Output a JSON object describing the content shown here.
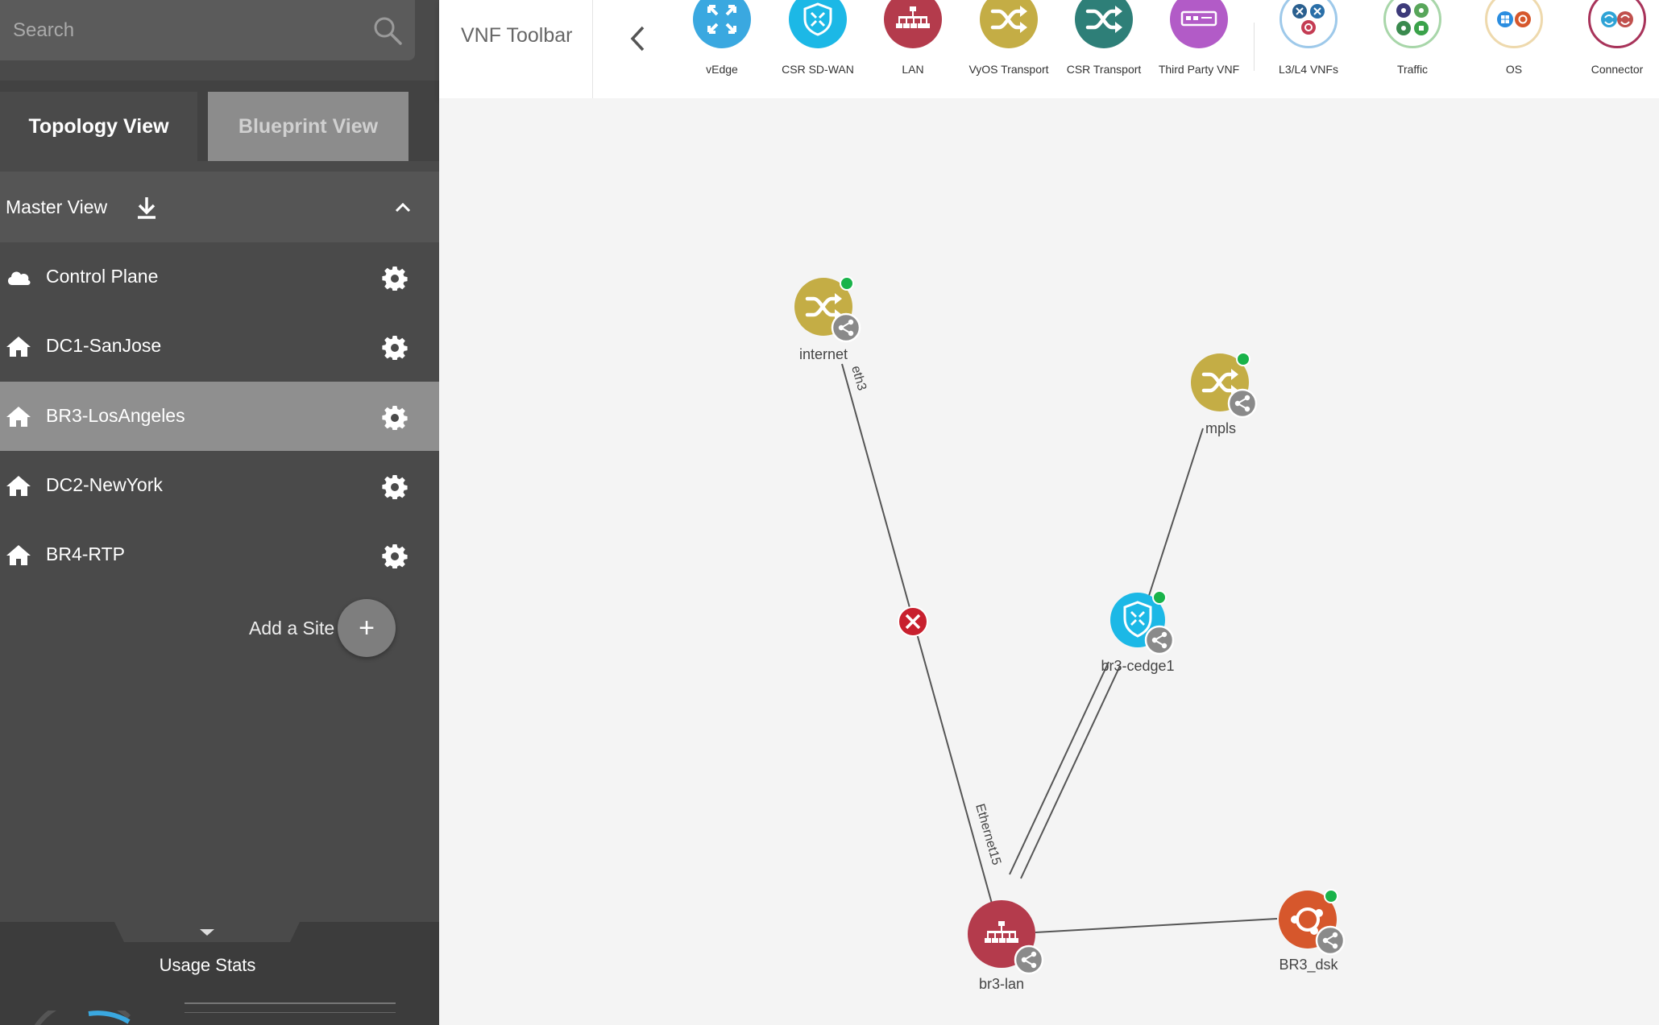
{
  "search": {
    "placeholder": "Search"
  },
  "tabs": {
    "topology": "Topology View",
    "blueprint": "Blueprint View"
  },
  "master": {
    "label": "Master View"
  },
  "sites": [
    {
      "label": "Control Plane",
      "icon": "cloud-icon"
    },
    {
      "label": "DC1-SanJose",
      "icon": "home-icon"
    },
    {
      "label": "BR3-LosAngeles",
      "icon": "home-icon",
      "selected": true
    },
    {
      "label": "DC2-NewYork",
      "icon": "home-icon"
    },
    {
      "label": "BR4-RTP",
      "icon": "home-icon"
    }
  ],
  "add_site": {
    "label": "Add a Site",
    "button": "+"
  },
  "usage": {
    "label": "Usage Stats"
  },
  "toolbar": {
    "title": "VNF Toolbar",
    "tools": [
      {
        "label": "vEdge",
        "color": "#3aa8e0"
      },
      {
        "label": "CSR SD-WAN",
        "color": "#1cb8e6"
      },
      {
        "label": "LAN",
        "color": "#b43b4c"
      },
      {
        "label": "VyOS Transport",
        "color": "#c4ad45"
      },
      {
        "label": "CSR Transport",
        "color": "#2e7f78"
      },
      {
        "label": "Third Party VNF",
        "color": "#b25bc7"
      },
      {
        "label": "L3/L4 VNFs",
        "color": "#3a86c8"
      },
      {
        "label": "Traffic",
        "color": "#58a65a"
      },
      {
        "label": "OS",
        "color": "#e3c07a"
      },
      {
        "label": "Connector",
        "color": "#a8335a"
      }
    ]
  },
  "topology": {
    "nodes": [
      {
        "id": "internet",
        "label": "internet",
        "type": "vyos-transport",
        "color": "#c4ad45",
        "status": "online"
      },
      {
        "id": "mpls",
        "label": "mpls",
        "type": "vyos-transport",
        "color": "#c4ad45",
        "status": "online"
      },
      {
        "id": "br3-cedge1",
        "label": "br3-cedge1",
        "type": "csr-sdwan",
        "color": "#1cb8e6",
        "status": "online"
      },
      {
        "id": "br3-lan",
        "label": "br3-lan",
        "type": "lan",
        "color": "#b43b4c"
      },
      {
        "id": "BR3_dsk",
        "label": "BR3_dsk",
        "type": "os-ubuntu",
        "color": "#d6572c",
        "status": "online"
      }
    ],
    "links": [
      {
        "from": "internet",
        "to": "br3-lan",
        "label_top": "eth3",
        "label_bottom": "Ethernet15",
        "state": "down"
      },
      {
        "from": "mpls",
        "to": "br3-cedge1"
      },
      {
        "from": "br3-cedge1",
        "to": "br3-lan"
      },
      {
        "from": "br3-cedge1",
        "to": "br3-lan"
      },
      {
        "from": "br3-lan",
        "to": "BR3_dsk"
      }
    ],
    "status_color": "#19b34a",
    "link_down_color": "#c8202e"
  }
}
